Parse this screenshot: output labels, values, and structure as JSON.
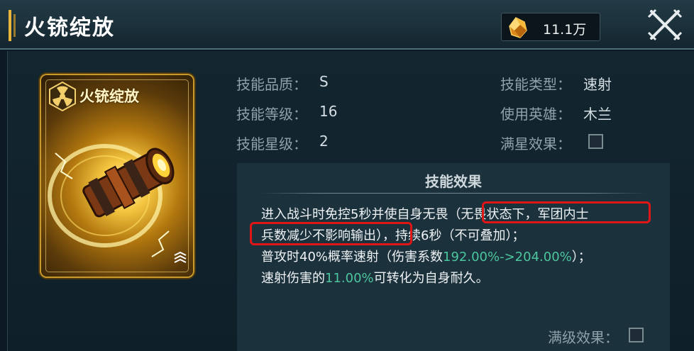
{
  "header": {
    "title": "火铳绽放",
    "currency_amount": "11.1万",
    "currency_icon": "amber-crystal-icon",
    "close_icon": "crossed-swords-close-icon"
  },
  "card": {
    "title": "火铳绽放",
    "emblem_icon": "hexagon-radiation-emblem-icon",
    "art": "golden-cannon-barrel-art",
    "corner_icon": "rank-chevrons-icon"
  },
  "info": {
    "quality_label": "技能品质：",
    "quality_value": "S",
    "level_label": "技能等级：",
    "level_value": "16",
    "star_label": "技能星级：",
    "star_value": "2",
    "type_label": "技能类型：",
    "type_value": "速射",
    "hero_label": "使用英雄：",
    "hero_value": "木兰",
    "full_star_label": "满星效果：",
    "full_star_checked": false
  },
  "effect": {
    "title": "技能效果",
    "line1_a": "进入战斗时免控5秒并使自身无畏",
    "line1_b": "（无畏状态下，军团内士",
    "line2_a": "兵数减少不影响输出）",
    "line2_b": "，持续6秒（不可叠加）；",
    "line3_a": "普攻时40%概率速射（伤害系数",
    "line3_hl": "192.00%->204.00%",
    "line3_b": "）；",
    "line4_a": "速射伤害的",
    "line4_hl": "11.00%",
    "line4_b": "可转化为自身耐久。",
    "full_level_label": "满级效果：",
    "full_level_checked": false
  },
  "colors": {
    "highlight": "#4cc69e",
    "annotation_red": "#e01616",
    "gold": "#e9b53a"
  }
}
